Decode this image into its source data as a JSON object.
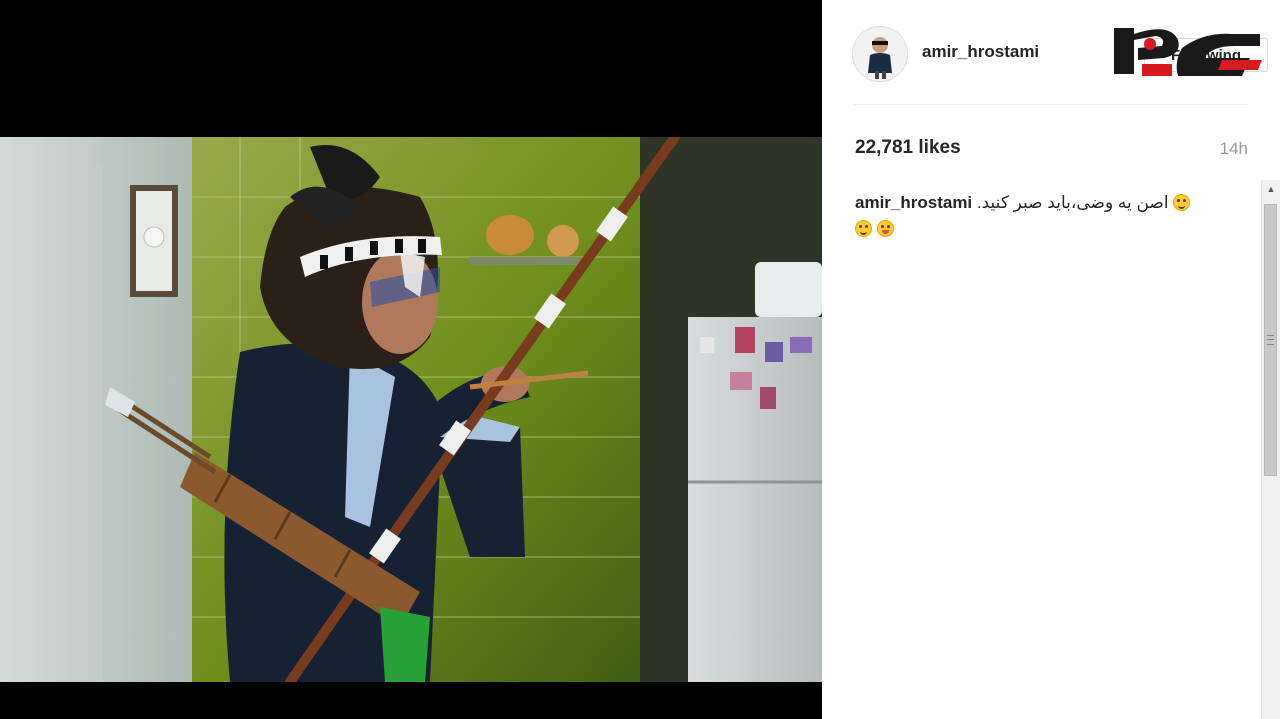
{
  "post": {
    "username": "amir_hrostami",
    "follow_label": "Following",
    "likes": "22,781 likes",
    "time": "14h",
    "caption_user": "amir_hrostami",
    "caption_text": "اصن یه وضی،باید صبر کنید.",
    "caption_emojis": [
      "tired-face-emoji",
      "grinning-emoji",
      "tongue-out-emoji"
    ]
  },
  "media": {
    "alt": "Photo of a man in costume aiming a bow"
  },
  "watermark": {
    "brand": "rokna",
    "colors": {
      "primary": "#1a1a1a",
      "accent": "#d71920"
    }
  },
  "colors": {
    "text": "#262626",
    "muted": "#999999",
    "border": "#dbdbdb"
  }
}
